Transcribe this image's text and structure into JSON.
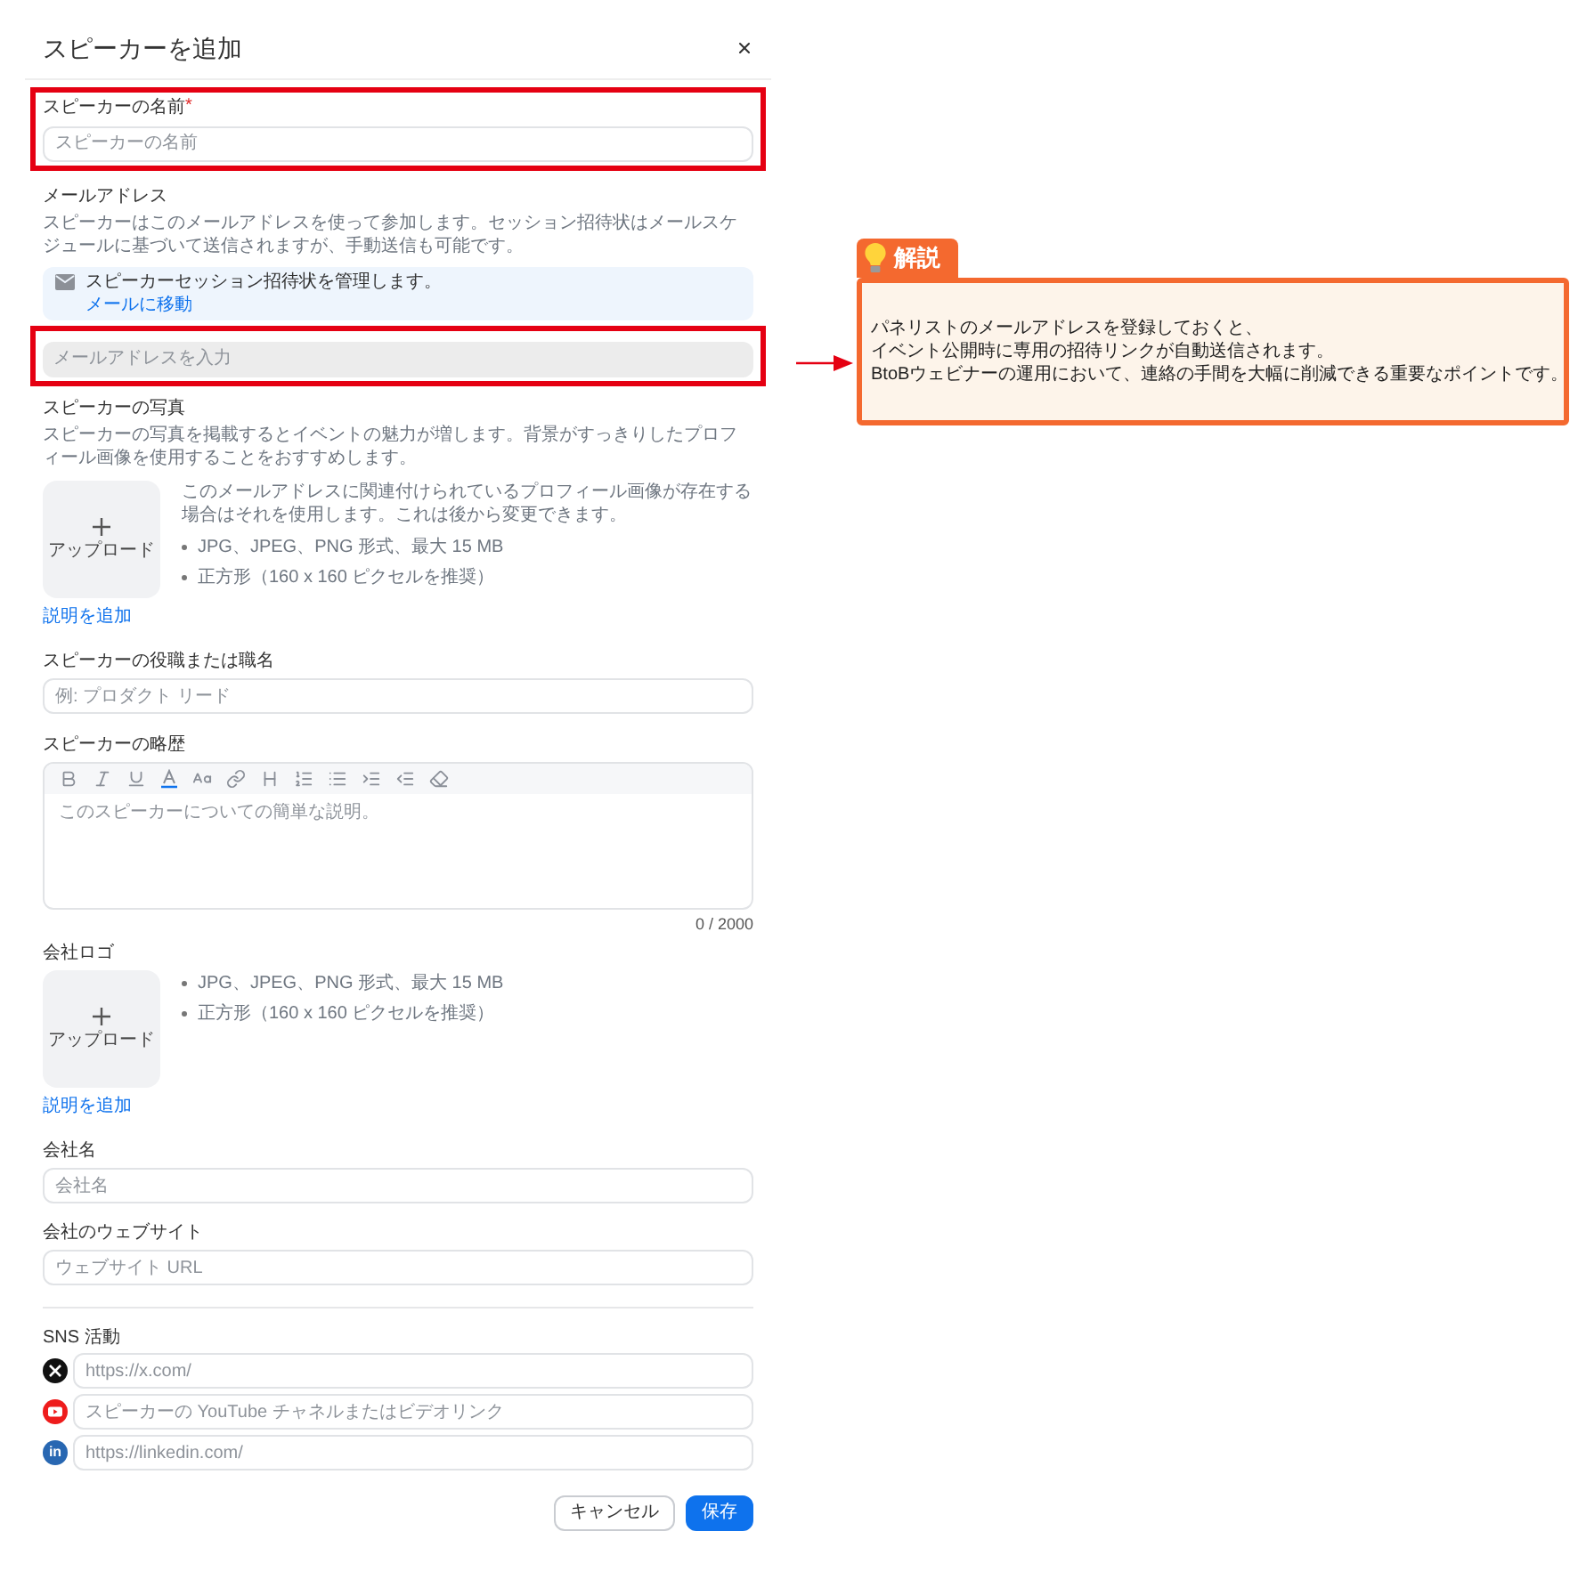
{
  "dialog": {
    "title": "スピーカーを追加"
  },
  "speaker_name": {
    "label": "スピーカーの名前",
    "required_mark": "*",
    "placeholder": "スピーカーの名前",
    "highlighted": true
  },
  "email": {
    "label": "メールアドレス",
    "description": "スピーカーはこのメールアドレスを使って参加します。セッション招待状はメールスケジュールに基づいて送信されますが、手動送信も可能です。",
    "notice": {
      "text": "スピーカーセッション招待状を管理します。",
      "link": "メールに移動"
    },
    "placeholder": "メールアドレスを入力",
    "highlighted": true
  },
  "photo": {
    "label": "スピーカーの写真",
    "description": "スピーカーの写真を掲載するとイベントの魅力が増します。背景がすっきりしたプロフィール画像を使用することをおすすめします。",
    "upload_label": "アップロード",
    "note": "このメールアドレスに関連付けられているプロフィール画像が存在する場合はそれを使用します。これは後から変更できます。",
    "requirements": [
      "JPG、JPEG、PNG 形式、最大 15 MB",
      "正方形（160 x 160 ピクセルを推奨）"
    ],
    "add_description": "説明を追加"
  },
  "job_title": {
    "label": "スピーカーの役職または職名",
    "placeholder": "例: プロダクト リード"
  },
  "bio": {
    "label": "スピーカーの略歴",
    "placeholder": "このスピーカーについての簡単な説明。",
    "counter": "0 / 2000"
  },
  "company_logo": {
    "label": "会社ロゴ",
    "upload_label": "アップロード",
    "requirements": [
      "JPG、JPEG、PNG 形式、最大 15 MB",
      "正方形（160 x 160 ピクセルを推奨）"
    ],
    "add_description": "説明を追加"
  },
  "company_name": {
    "label": "会社名",
    "placeholder": "会社名"
  },
  "company_website": {
    "label": "会社のウェブサイト",
    "placeholder": "ウェブサイト URL"
  },
  "sns": {
    "label": "SNS 活動",
    "links": [
      {
        "kind": "x",
        "placeholder": "https://x.com/"
      },
      {
        "kind": "youtube",
        "placeholder": "スピーカーの YouTube チャネルまたはビデオリンク"
      },
      {
        "kind": "linkedin",
        "icon_text": "in",
        "placeholder": "https://linkedin.com/"
      }
    ]
  },
  "buttons": [
    {
      "kind": "secondary",
      "label": "キャンセル"
    },
    {
      "kind": "primary",
      "label": "保存"
    }
  ],
  "callout": {
    "title": "解説",
    "lines": [
      "パネリストのメールアドレスを登録しておくと、",
      "イベント公開時に専用の招待リンクが自動送信されます。",
      "BtoBウェビナーの運用において、連絡の手間を大幅に削減できる重要なポイントです。"
    ]
  }
}
